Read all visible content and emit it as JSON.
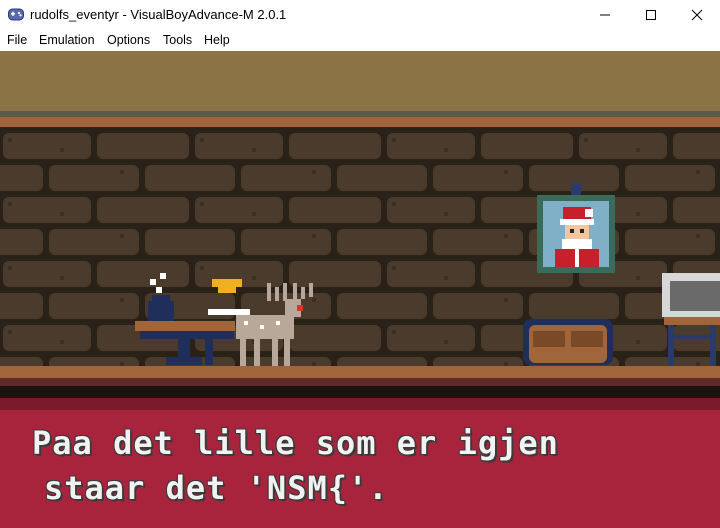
{
  "window": {
    "title": "rudolfs_eventyr - VisualBoyAdvance-M 2.0.1",
    "app_icon": "gamepad-icon",
    "controls": {
      "minimize_icon": "minimize-icon",
      "maximize_icon": "maximize-icon",
      "close_icon": "close-icon"
    }
  },
  "menu": {
    "items": [
      "File",
      "Emulation",
      "Options",
      "Tools",
      "Help"
    ]
  },
  "game": {
    "scene": {
      "sprites": [
        "reindeer",
        "table",
        "teapot",
        "cake-slice",
        "santa-portrait",
        "sofa",
        "tv-set"
      ]
    },
    "dialog": {
      "line1": "Paa det lille som er igjen",
      "line2": "staar det 'NSM{'."
    }
  },
  "colors": {
    "ceiling": "#8c7346",
    "wall_brick": "#4a3b2c",
    "mortar": "#2a2119",
    "floor_trim": "#a0653a",
    "dialog_box": "#a8243c",
    "dialog_text": "#f2f2f2"
  }
}
